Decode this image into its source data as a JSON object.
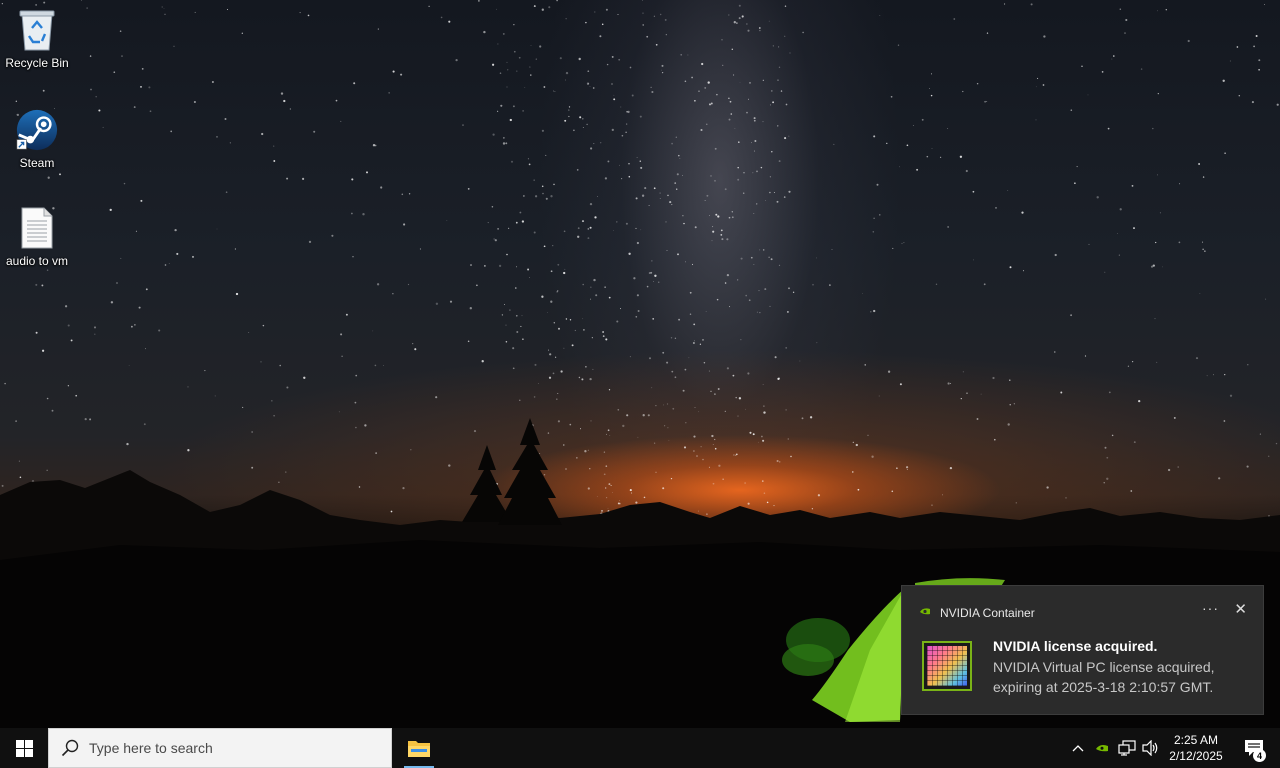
{
  "desktop": {
    "icons": [
      {
        "label": "Recycle Bin",
        "icon": "recycle-bin-icon"
      },
      {
        "label": "Steam",
        "icon": "steam-icon"
      },
      {
        "label": "audio to vm",
        "icon": "text-file-icon"
      }
    ]
  },
  "notification": {
    "app_name": "NVIDIA Container",
    "more_label": "···",
    "close_label": "✕",
    "title": "NVIDIA license acquired.",
    "body": "NVIDIA Virtual PC license acquired, expiring at 2025-3-18 2:10:57 GMT.",
    "accent_color": "#76b900"
  },
  "taskbar": {
    "search_placeholder": "Type here to search",
    "pinned": [
      "file-explorer-icon"
    ],
    "tray": {
      "icons": [
        "chevron-up-icon",
        "nvidia-tray-icon",
        "network-icon",
        "volume-icon"
      ],
      "time": "2:25 AM",
      "date": "2/12/2025",
      "notification_count": "4"
    }
  }
}
